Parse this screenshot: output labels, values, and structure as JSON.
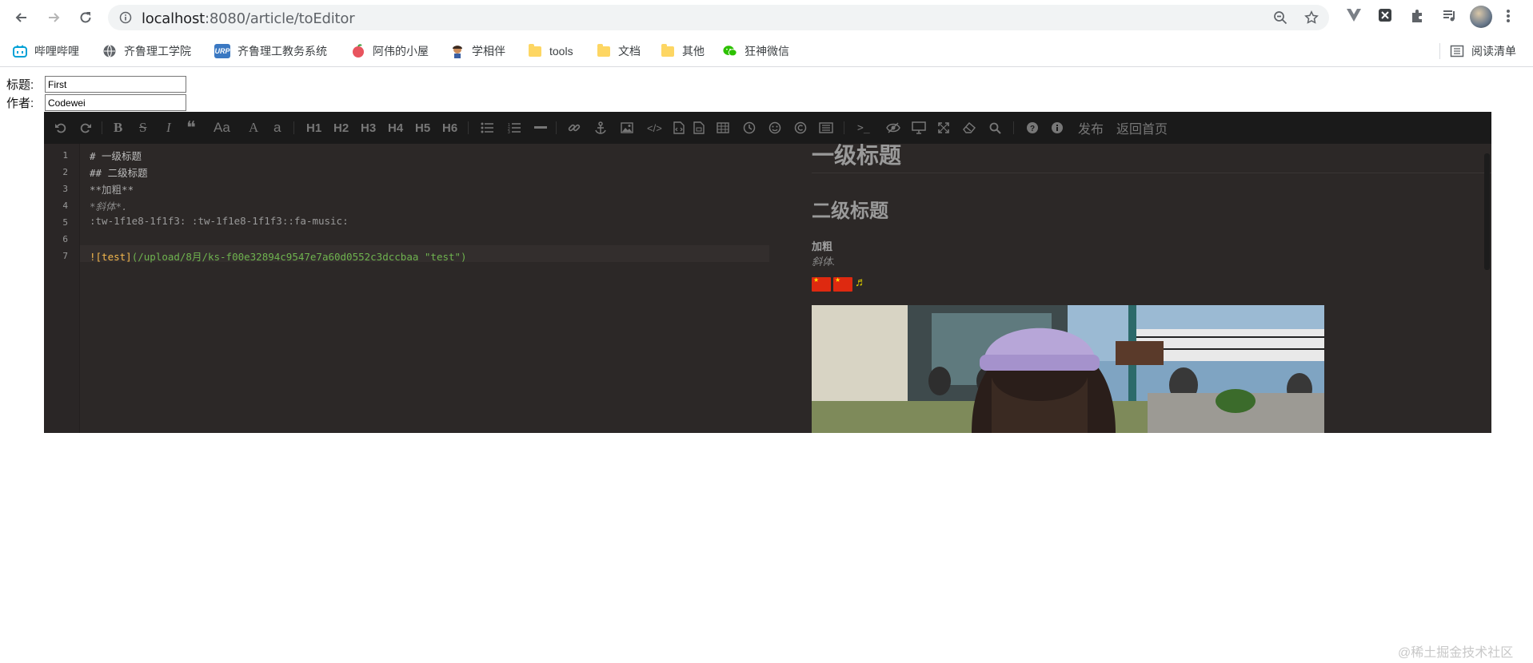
{
  "browser": {
    "url_host": "localhost",
    "url_rest": ":8080/article/toEditor",
    "bookmarks": [
      {
        "label": "哔哩哔哩",
        "icon": "bilibili-icon"
      },
      {
        "label": "齐鲁理工学院",
        "icon": "globe-icon"
      },
      {
        "label": "齐鲁理工教务系统",
        "icon": "urp-icon"
      },
      {
        "label": "阿伟的小屋",
        "icon": "peach-icon"
      },
      {
        "label": "学相伴",
        "icon": "avatar-icon"
      },
      {
        "label": "tools",
        "icon": "folder-icon"
      },
      {
        "label": "文档",
        "icon": "folder-icon"
      },
      {
        "label": "其他",
        "icon": "folder-icon"
      },
      {
        "label": "狂神微信",
        "icon": "wechat-icon"
      }
    ],
    "reading_list": "阅读清单"
  },
  "form": {
    "title_label": "标题:",
    "title_value": "First",
    "author_label": "作者:",
    "author_value": "Codewei"
  },
  "editor": {
    "toolbar": {
      "headings": [
        "H1",
        "H2",
        "H3",
        "H4",
        "H5",
        "H6"
      ],
      "aa": "Aa",
      "publish": "发布",
      "back_home": "返回首页"
    },
    "line_numbers": [
      "1",
      "2",
      "3",
      "4",
      "5",
      "6",
      "7"
    ],
    "lines": {
      "l1": "# 一级标题",
      "l2": "## 二级标题",
      "l3": "**加粗**",
      "l4": "*斜体*.",
      "l5": ":tw-1f1e8-1f1f3: :tw-1f1e8-1f1f3::fa-music:",
      "l7_link": "![test]",
      "l7_url": "(/upload/8月/ks-f00e32894c9547e7a60d0552c3dccbaa \"test\")"
    },
    "preview": {
      "h1": "一级标题",
      "h2": "二级标题",
      "bold": "加粗",
      "italic": "斜体."
    }
  },
  "watermark": "@稀土掘金技术社区"
}
